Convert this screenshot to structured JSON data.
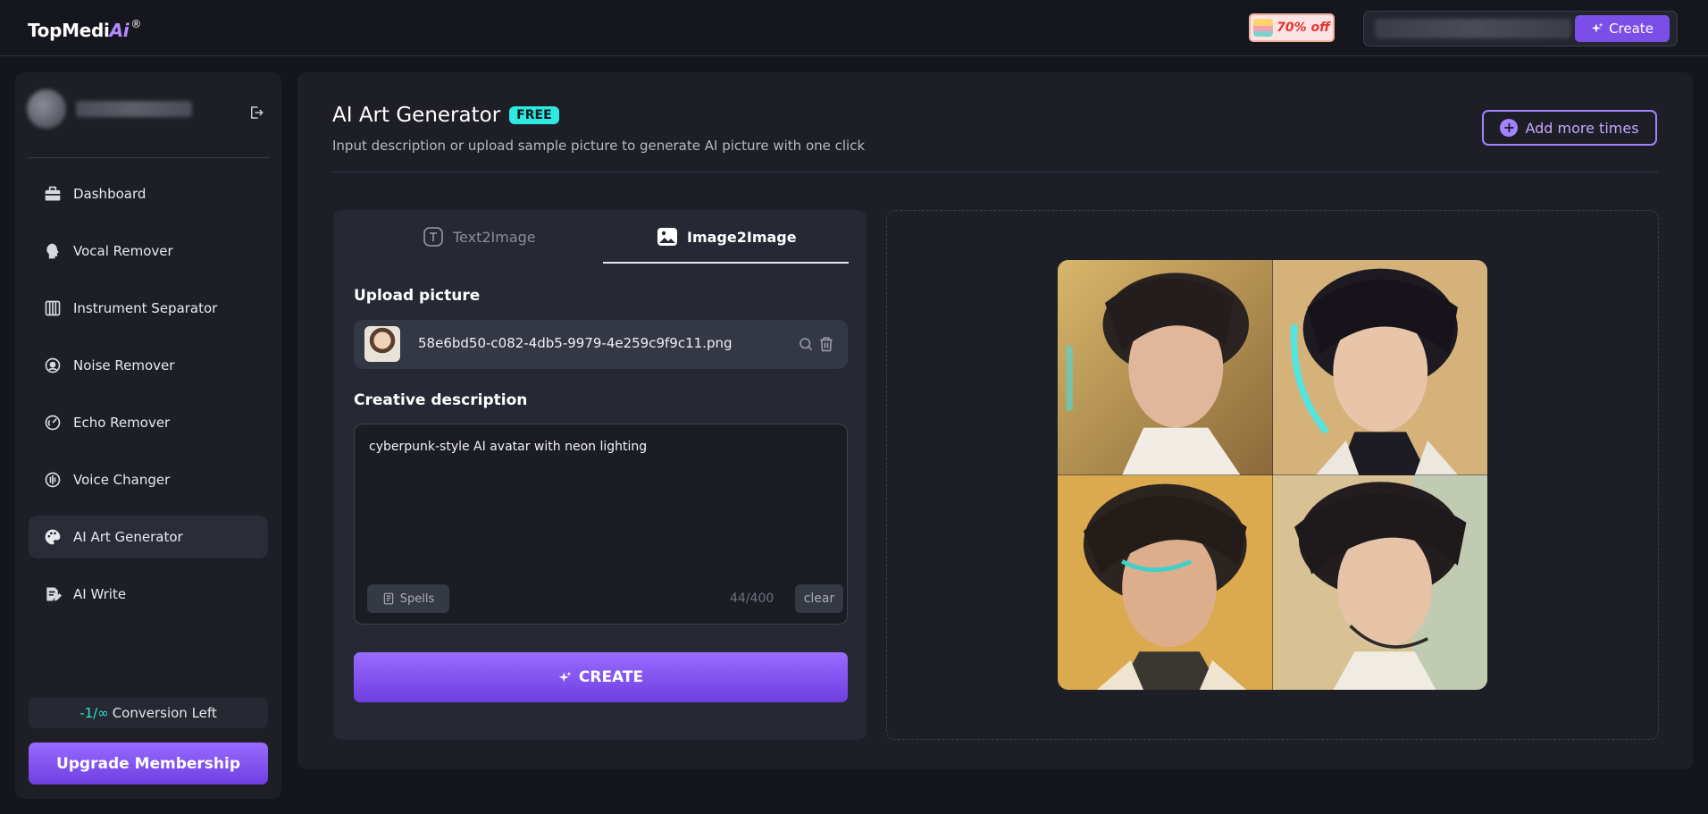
{
  "brand": {
    "name_prefix": "TopMedi",
    "name_ai": "Ai",
    "mark": "®"
  },
  "topbar": {
    "promo_text": "70% off",
    "create_label": "Create"
  },
  "sidebar": {
    "items": [
      {
        "label": "Dashboard",
        "icon": "briefcase-icon"
      },
      {
        "label": "Vocal Remover",
        "icon": "head-icon"
      },
      {
        "label": "Instrument Separator",
        "icon": "piano-icon"
      },
      {
        "label": "Noise Remover",
        "icon": "noise-icon"
      },
      {
        "label": "Echo Remover",
        "icon": "echo-icon"
      },
      {
        "label": "Voice Changer",
        "icon": "voice-changer-icon"
      },
      {
        "label": "AI Art Generator",
        "icon": "palette-icon",
        "active": true
      },
      {
        "label": "AI Write",
        "icon": "write-icon"
      }
    ],
    "conversion": {
      "value": "-1/∞",
      "label": "Conversion Left"
    },
    "upgrade_label": "Upgrade Membership"
  },
  "main": {
    "title": "AI Art Generator",
    "badge": "FREE",
    "subtitle": "Input description or upload sample picture to generate AI picture with one click",
    "add_more_label": "Add more times",
    "tabs": [
      {
        "label": "Text2Image",
        "active": false
      },
      {
        "label": "Image2Image",
        "active": true
      }
    ],
    "upload_label": "Upload picture",
    "file_name": "58e6bd50-c082-4db5-9979-4e259c9f9c11.png",
    "description_label": "Creative description",
    "description_text": "cyberpunk-style AI avatar with neon lighting",
    "spells_label": "Spells",
    "char_count": "44/400",
    "clear_label": "clear",
    "create_label": "CREATE"
  },
  "colors": {
    "accent": "#7c4ee8",
    "accent_light": "#a582ff",
    "badge_teal": "#2fe9e0",
    "panel_bg": "#1d1e26"
  }
}
